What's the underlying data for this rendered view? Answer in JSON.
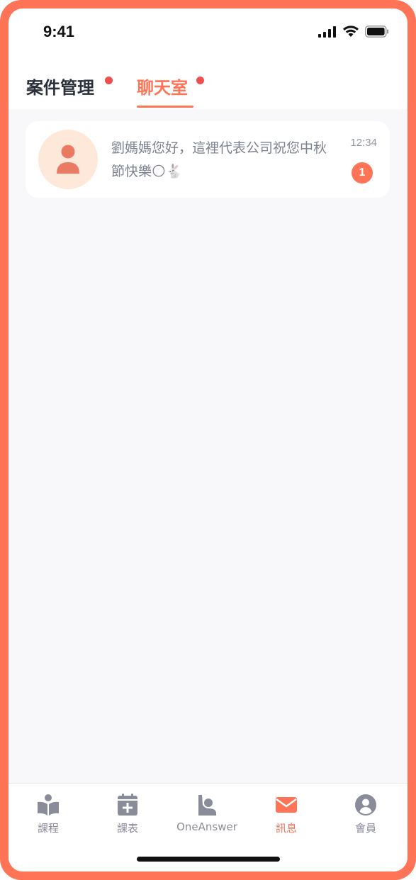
{
  "status_bar": {
    "time": "9:41"
  },
  "header": {
    "tabs": [
      {
        "label": "案件管理",
        "active": false,
        "has_dot": true
      },
      {
        "label": "聊天室",
        "active": true,
        "has_dot": true
      }
    ]
  },
  "chat_list": [
    {
      "avatar_icon": "person-icon",
      "message": "劉媽媽您好，這裡代表公司祝您中秋節快樂🌕🐇",
      "time": "12:34",
      "unread": "1"
    }
  ],
  "bottom_nav": {
    "items": [
      {
        "label": "課程",
        "icon": "book-icon",
        "active": false
      },
      {
        "label": "課表",
        "icon": "calendar-add-icon",
        "active": false
      },
      {
        "label": "OneAnswer",
        "icon": "raise-hand-icon",
        "active": false
      },
      {
        "label": "訊息",
        "icon": "mail-icon",
        "active": true
      },
      {
        "label": "會員",
        "icon": "user-circle-icon",
        "active": false
      }
    ]
  },
  "colors": {
    "accent": "#ff7357",
    "dot": "#f04e4e",
    "inactive": "#8a8d99",
    "avatar_bg": "#fde8da"
  }
}
